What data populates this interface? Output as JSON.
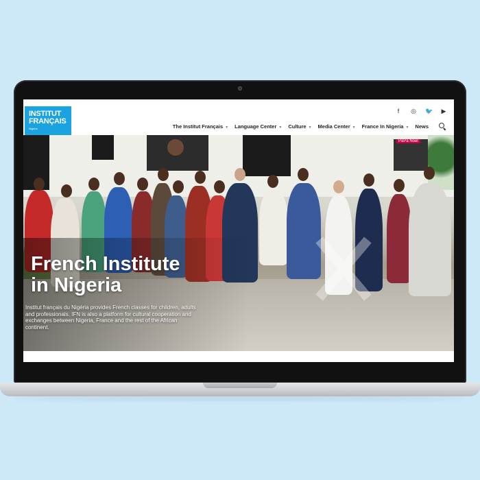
{
  "logo": {
    "line1": "INSTITUT",
    "line2": "FRANÇAIS",
    "sub": "Nigeria"
  },
  "social": [
    {
      "icon": "facebook-icon",
      "glyph": "f"
    },
    {
      "icon": "instagram-icon",
      "glyph": "◎"
    },
    {
      "icon": "twitter-icon",
      "glyph": "🐦"
    },
    {
      "icon": "youtube-icon",
      "glyph": "▶"
    }
  ],
  "nav": {
    "items": [
      {
        "label": "The Institut Français",
        "has_dropdown": true
      },
      {
        "label": "Language Center",
        "has_dropdown": true
      },
      {
        "label": "Culture",
        "has_dropdown": true
      },
      {
        "label": "Media Center",
        "has_dropdown": true
      },
      {
        "label": "France In Nigeria",
        "has_dropdown": true
      },
      {
        "label": "News",
        "has_dropdown": false
      }
    ],
    "caret": "▼"
  },
  "hero": {
    "title_line1": "French Institute",
    "title_line2": "in Nigeria",
    "description": "Institut français du Nigéria provides French classes for children, adults and professionals. IFN is also a platform for cultural cooperation and exchanges between Nigeria, France and the rest of the African continent."
  },
  "colors": {
    "background": "#cde9f8",
    "logo_bg": "#1aa3e0",
    "nav_text": "#222222"
  }
}
